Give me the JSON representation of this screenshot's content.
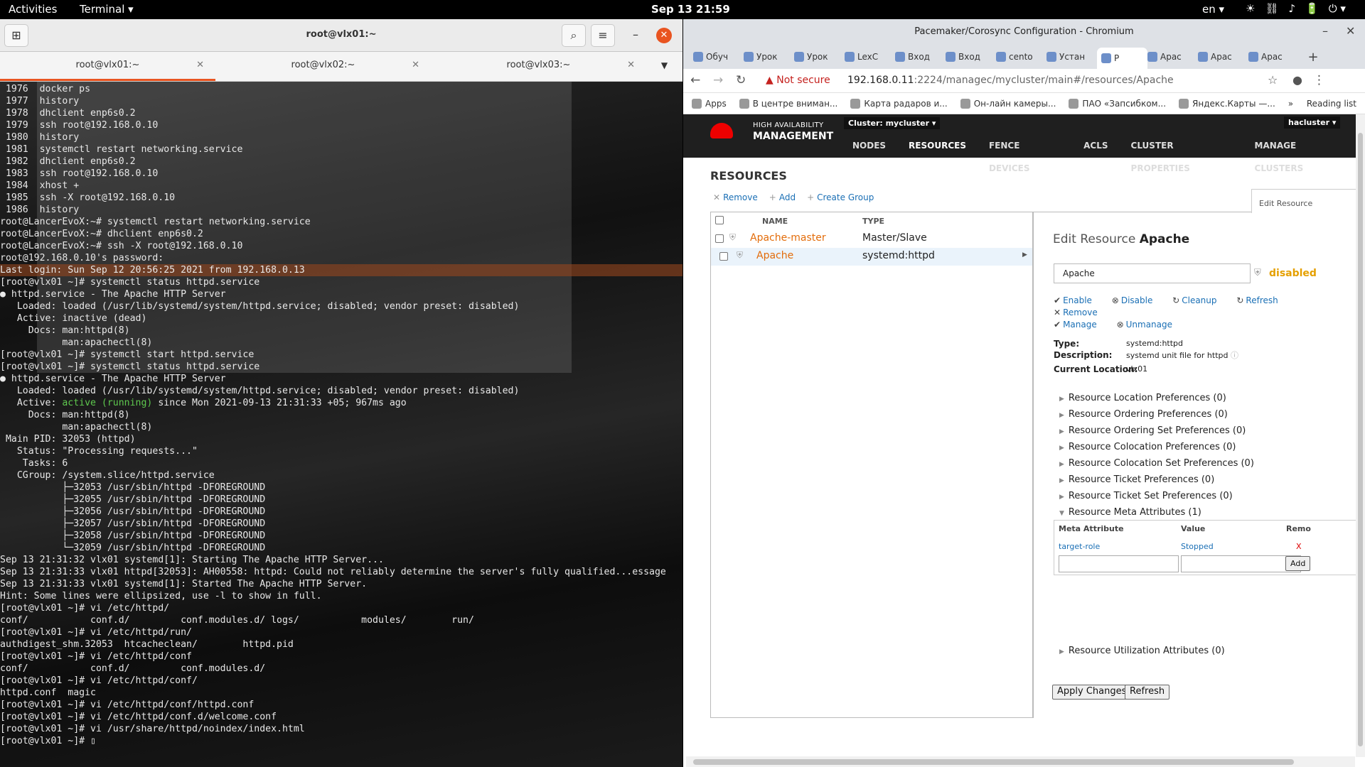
{
  "topbar": {
    "activities": "Activities",
    "app": "Terminal ▾",
    "clock": "Sep 13  21:59",
    "lang": "en ▾",
    "tray": [
      "☀",
      "⛓",
      "♪",
      "🔋",
      "⏻ ▾"
    ]
  },
  "terminal": {
    "title": "root@vlx01:~",
    "tabs": [
      {
        "label": "root@vlx01:~"
      },
      {
        "label": "root@vlx02:~"
      },
      {
        "label": "root@vlx03:~"
      }
    ],
    "lines": [
      " 1976  docker ps",
      " 1977  history",
      " 1978  dhclient enp6s0.2",
      " 1979  ssh root@192.168.0.10",
      " 1980  history",
      " 1981  systemctl restart networking.service",
      " 1982  dhclient enp6s0.2",
      " 1983  ssh root@192.168.0.10",
      " 1984  xhost +",
      " 1985  ssh -X root@192.168.0.10",
      " 1986  history",
      "root@LancerEvoX:~# systemctl restart networking.service",
      "root@LancerEvoX:~# dhclient enp6s0.2",
      "root@LancerEvoX:~# ssh -X root@192.168.0.10",
      "root@192.168.0.10's password:",
      "Last login: Sun Sep 12 20:56:25 2021 from 192.168.0.13",
      "[root@vlx01 ~]# systemctl status httpd.service",
      "● httpd.service - The Apache HTTP Server",
      "   Loaded: loaded (/usr/lib/systemd/system/httpd.service; disabled; vendor preset: disabled)",
      "   Active: inactive (dead)",
      "     Docs: man:httpd(8)",
      "           man:apachectl(8)",
      "[root@vlx01 ~]# systemctl start httpd.service",
      "[root@vlx01 ~]# systemctl status httpd.service",
      "● httpd.service - The Apache HTTP Server",
      "   Loaded: loaded (/usr/lib/systemd/system/httpd.service; disabled; vendor preset: disabled)",
      "   Active: active (running) since Mon 2021-09-13 21:31:33 +05; 967ms ago",
      "     Docs: man:httpd(8)",
      "           man:apachectl(8)",
      " Main PID: 32053 (httpd)",
      "   Status: \"Processing requests...\"",
      "    Tasks: 6",
      "   CGroup: /system.slice/httpd.service",
      "           ├─32053 /usr/sbin/httpd -DFOREGROUND",
      "           ├─32055 /usr/sbin/httpd -DFOREGROUND",
      "           ├─32056 /usr/sbin/httpd -DFOREGROUND",
      "           ├─32057 /usr/sbin/httpd -DFOREGROUND",
      "           ├─32058 /usr/sbin/httpd -DFOREGROUND",
      "           └─32059 /usr/sbin/httpd -DFOREGROUND",
      "",
      "Sep 13 21:31:32 vlx01 systemd[1]: Starting The Apache HTTP Server...",
      "Sep 13 21:31:33 vlx01 httpd[32053]: AH00558: httpd: Could not reliably determine the server's fully qualified...essage",
      "Sep 13 21:31:33 vlx01 systemd[1]: Started The Apache HTTP Server.",
      "Hint: Some lines were ellipsized, use -l to show in full.",
      "[root@vlx01 ~]# vi /etc/httpd/",
      "conf/           conf.d/         conf.modules.d/ logs/           modules/        run/",
      "[root@vlx01 ~]# vi /etc/httpd/run/",
      "authdigest_shm.32053  htcacheclean/        httpd.pid",
      "[root@vlx01 ~]# vi /etc/httpd/conf",
      "conf/           conf.d/         conf.modules.d/",
      "[root@vlx01 ~]# vi /etc/httpd/conf/",
      "httpd.conf  magic",
      "[root@vlx01 ~]# vi /etc/httpd/conf/httpd.conf",
      "[root@vlx01 ~]# vi /etc/httpd/conf.d/welcome.conf",
      "[root@vlx01 ~]# vi /usr/share/httpd/noindex/index.html",
      "[root@vlx01 ~]# ▯"
    ]
  },
  "browser": {
    "window_title": "Pacemaker/Corosync Configuration - Chromium",
    "tabs": [
      "Обуч",
      "Урок",
      "Урок",
      "LexC",
      "Вход",
      "Вход",
      "cento",
      "Устан",
      "P",
      "Apac",
      "Apac",
      "Apac"
    ],
    "not_secure": "Not secure",
    "url_host": "192.168.0.11",
    "url_rest": ":2224/managec/mycluster/main#/resources/Apache",
    "bookmarks": [
      "Apps",
      "В центре вниман...",
      "Карта радаров и...",
      "Он-лайн камеры...",
      "ПАО «Запсибком...",
      "Яндекс.Карты —..."
    ],
    "reading_list": "Reading list",
    "more": "»"
  },
  "pcs": {
    "brand_line1": "HIGH AVAILABILITY",
    "brand_line2": "MANAGEMENT",
    "cluster": "Cluster: mycluster ▾",
    "user": "hacluster ▾",
    "nav": [
      "NODES",
      "RESOURCES",
      "FENCE DEVICES",
      "ACLS",
      "CLUSTER PROPERTIES",
      "MANAGE CLUSTERS"
    ],
    "resources_title": "RESOURCES",
    "actions": {
      "remove": "Remove",
      "add": "Add",
      "create_group": "Create Group"
    },
    "list_headers": {
      "name": "NAME",
      "type": "TYPE"
    },
    "rows": [
      {
        "name": "Apache-master",
        "type": "Master/Slave"
      },
      {
        "name": "Apache",
        "type": "systemd:httpd"
      }
    ],
    "edit": {
      "tab_label": "Edit Resource",
      "title_prefix": "Edit Resource",
      "title_name": "Apache",
      "input_value": "Apache",
      "status": "disabled",
      "ops": [
        "Enable",
        "Disable",
        "Cleanup",
        "Refresh",
        "Remove",
        "Manage",
        "Unmanage"
      ],
      "type_label": "Type:",
      "type_value": "systemd:httpd",
      "desc_label": "Description:",
      "desc_value": "systemd unit file for httpd",
      "loc_label": "Current Location:",
      "loc_value": "vlx01",
      "prefs": [
        "Resource Location Preferences (0)",
        "Resource Ordering Preferences (0)",
        "Resource Ordering Set Preferences (0)",
        "Resource Colocation Preferences (0)",
        "Resource Colocation Set Preferences (0)",
        "Resource Ticket Preferences (0)",
        "Resource Ticket Set Preferences (0)",
        "Resource Meta Attributes (1)"
      ],
      "meta_headers": {
        "attr": "Meta Attribute",
        "value": "Value",
        "remove": "Remo"
      },
      "meta_row": {
        "attr": "target-role",
        "value": "Stopped",
        "remove": "X"
      },
      "add_btn": "Add",
      "util_pref": "Resource Utilization Attributes (0)",
      "apply_btn": "Apply Changes",
      "refresh_btn": "Refresh"
    }
  }
}
